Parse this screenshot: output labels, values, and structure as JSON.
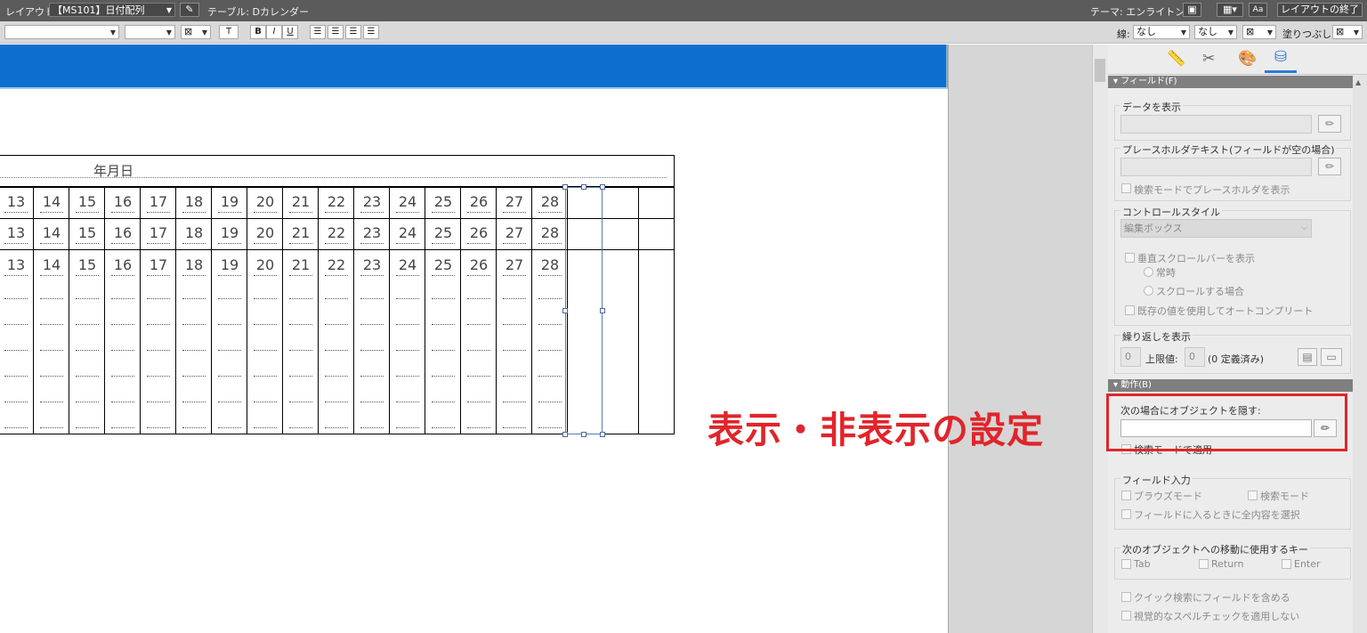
{
  "toolbar": {
    "layout_label": "レイアウト:",
    "layout_value": "【MS101】日付配列",
    "table_label": "テーブル: Dカレンダー",
    "theme_label": "テーマ: エンライトンド",
    "exit_layout": "レイアウトの終了",
    "aa_label": "Aa"
  },
  "format_bar": {
    "bold": "B",
    "italic": "I",
    "underline": "U",
    "text_btn": "T",
    "line_label": "線:",
    "line_value": "なし",
    "line_value2": "なし",
    "fill_label": "塗りつぶし:"
  },
  "table": {
    "header": "年月日",
    "days": [
      "13",
      "14",
      "15",
      "16",
      "17",
      "18",
      "19",
      "20",
      "21",
      "22",
      "23",
      "24",
      "25",
      "26",
      "27",
      "28"
    ]
  },
  "annotation": {
    "text": "表示・非表示の設定",
    "color": "#e0252b"
  },
  "inspector": {
    "field_section": "フィールド(F)",
    "display_data": "データを表示",
    "placeholder_label": "プレースホルダテキスト(フィールドが空の場合)",
    "placeholder_search_mode": "検索モードでプレースホルダを表示",
    "control_style": "コントロールスタイル",
    "control_style_value": "編集ボックス",
    "vertical_scroll": "垂直スクロールバーを表示",
    "always": "常時",
    "when_scrolling": "スクロールする場合",
    "auto_complete": "既存の値を使用してオートコンプリート",
    "repeat_label": "繰り返しを表示",
    "repeat_start": "0",
    "upper_limit": "上限値:",
    "upper_value": "0",
    "defined": "(0 定義済み)",
    "behavior_section": "動作(B)",
    "hide_object": "次の場合にオブジェクトを隠す:",
    "apply_in_find": "検索モードで適用",
    "field_entry": "フィールド入力",
    "browse_mode": "ブラウズモード",
    "find_mode": "検索モード",
    "select_all": "フィールドに入るときに全内容を選択",
    "next_object_keys": "次のオブジェクトへの移動に使用するキー",
    "key_tab": "Tab",
    "key_return": "Return",
    "key_enter": "Enter",
    "quick_find": "クイック検索にフィールドを含める",
    "no_spellcheck": "視覚的なスペルチェックを適用しない"
  }
}
